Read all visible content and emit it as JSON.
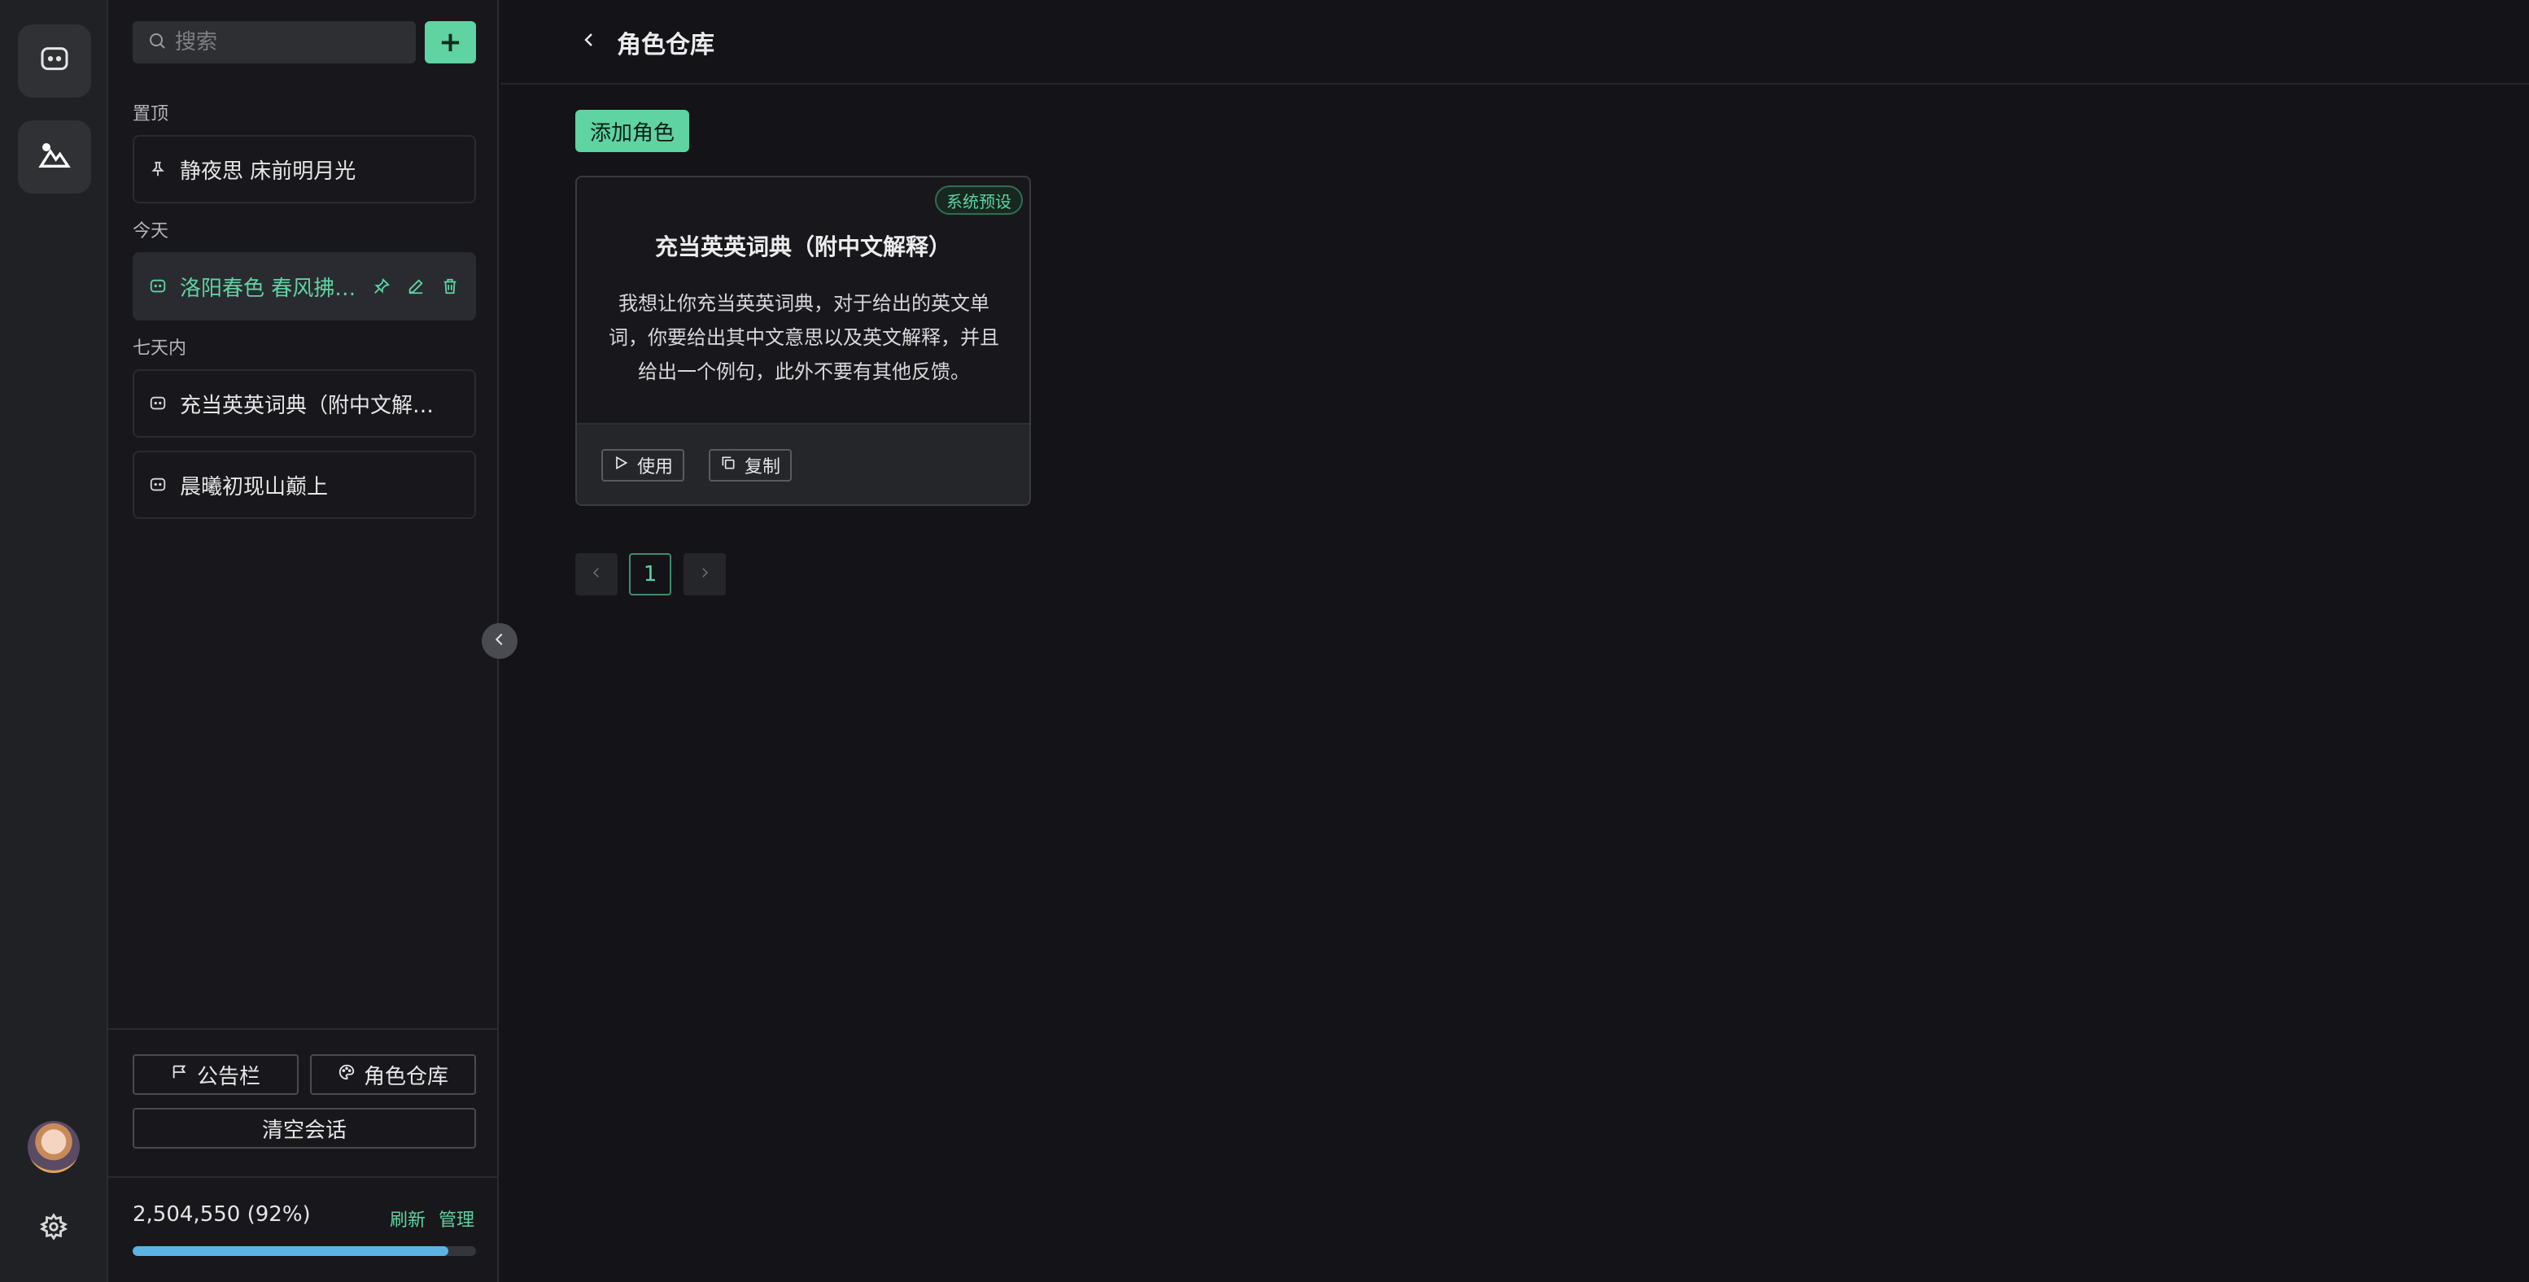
{
  "sidebar": {
    "search_placeholder": "搜索",
    "sections": {
      "pinned": "置顶",
      "today": "今天",
      "week": "七天内"
    },
    "conversations": [
      {
        "title": "静夜思 床前明月光",
        "section": "pinned",
        "icon": "pin-icon"
      },
      {
        "title": "洛阳春色 春风拂…",
        "section": "today",
        "active": true,
        "icon": "chat-icon"
      },
      {
        "title": "充当英英词典（附中文解…",
        "section": "week",
        "icon": "chat-icon"
      },
      {
        "title": "晨曦初现山巅上",
        "section": "week",
        "icon": "chat-icon"
      }
    ],
    "buttons": {
      "notice": "公告栏",
      "role_store": "角色仓库",
      "clear": "清空会话"
    },
    "quota": {
      "text": "2,504,550 (92%)",
      "percent": 92,
      "refresh": "刷新",
      "manage": "管理"
    }
  },
  "main": {
    "title": "角色仓库",
    "add_role": "添加角色",
    "cards": [
      {
        "badge": "系统预设",
        "title": "充当英英词典（附中文解释）",
        "description": "我想让你充当英英词典，对于给出的英文单词，你要给出其中文意思以及英文解释，并且给出一个例句，此外不要有其他反馈。",
        "use": "使用",
        "copy": "复制"
      }
    ],
    "pagination": {
      "current": "1"
    }
  },
  "colors": {
    "accent": "#5fd3a1",
    "progress": "#5cb3e4",
    "background": "#131318"
  }
}
